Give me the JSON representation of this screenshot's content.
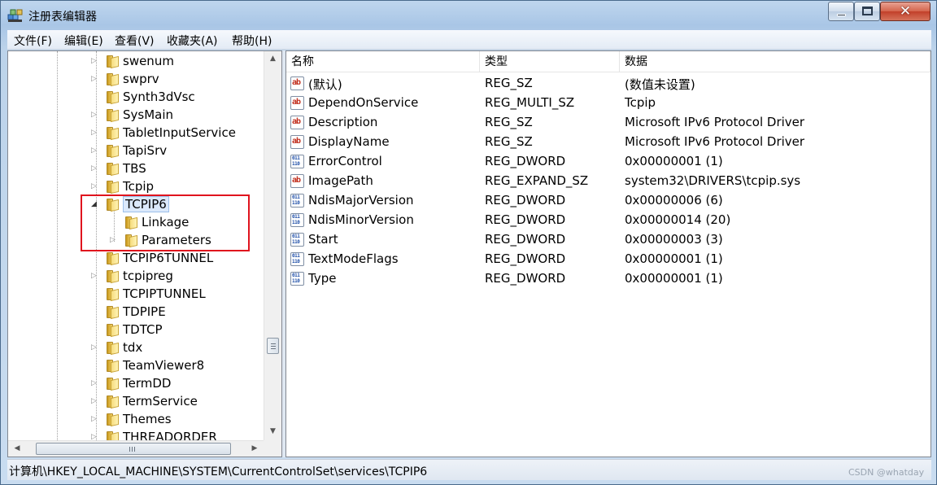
{
  "window": {
    "title": "注册表编辑器",
    "close_glyph": "✕"
  },
  "menu": [
    {
      "label": "文件(F)"
    },
    {
      "label": "编辑(E)"
    },
    {
      "label": "查看(V)"
    },
    {
      "label": "收藏夹(A)"
    },
    {
      "label": "帮助(H)"
    }
  ],
  "tree": {
    "items": [
      {
        "label": "swenum",
        "expander": "▷",
        "level": 1
      },
      {
        "label": "swprv",
        "expander": "▷",
        "level": 1
      },
      {
        "label": "Synth3dVsc",
        "expander": "",
        "level": 1
      },
      {
        "label": "SysMain",
        "expander": "▷",
        "level": 1
      },
      {
        "label": "TabletInputService",
        "expander": "▷",
        "level": 1
      },
      {
        "label": "TapiSrv",
        "expander": "▷",
        "level": 1
      },
      {
        "label": "TBS",
        "expander": "▷",
        "level": 1
      },
      {
        "label": "Tcpip",
        "expander": "▷",
        "level": 1
      },
      {
        "label": "TCPIP6",
        "expander": "◢",
        "level": 1,
        "selected": true
      },
      {
        "label": "Linkage",
        "expander": "",
        "level": 2
      },
      {
        "label": "Parameters",
        "expander": "▷",
        "level": 2
      },
      {
        "label": "TCPIP6TUNNEL",
        "expander": "",
        "level": 1
      },
      {
        "label": "tcpipreg",
        "expander": "▷",
        "level": 1
      },
      {
        "label": "TCPIPTUNNEL",
        "expander": "",
        "level": 1
      },
      {
        "label": "TDPIPE",
        "expander": "",
        "level": 1
      },
      {
        "label": "TDTCP",
        "expander": "",
        "level": 1
      },
      {
        "label": "tdx",
        "expander": "▷",
        "level": 1
      },
      {
        "label": "TeamViewer8",
        "expander": "",
        "level": 1
      },
      {
        "label": "TermDD",
        "expander": "▷",
        "level": 1
      },
      {
        "label": "TermService",
        "expander": "▷",
        "level": 1
      },
      {
        "label": "Themes",
        "expander": "▷",
        "level": 1
      },
      {
        "label": "THREADORDER",
        "expander": "▷",
        "level": 1
      }
    ],
    "scroll_up": "▲",
    "scroll_down": "▼",
    "scroll_left": "◀",
    "scroll_right": "▶"
  },
  "list": {
    "columns": [
      "名称",
      "类型",
      "数据"
    ],
    "rows": [
      {
        "icon": "string-value-icon",
        "name": "(默认)",
        "type": "REG_SZ",
        "data": "(数值未设置)"
      },
      {
        "icon": "string-value-icon",
        "name": "DependOnService",
        "type": "REG_MULTI_SZ",
        "data": "Tcpip"
      },
      {
        "icon": "string-value-icon",
        "name": "Description",
        "type": "REG_SZ",
        "data": "Microsoft IPv6 Protocol Driver"
      },
      {
        "icon": "string-value-icon",
        "name": "DisplayName",
        "type": "REG_SZ",
        "data": "Microsoft IPv6 Protocol Driver"
      },
      {
        "icon": "binary-value-icon",
        "name": "ErrorControl",
        "type": "REG_DWORD",
        "data": "0x00000001 (1)"
      },
      {
        "icon": "string-value-icon",
        "name": "ImagePath",
        "type": "REG_EXPAND_SZ",
        "data": "system32\\DRIVERS\\tcpip.sys"
      },
      {
        "icon": "binary-value-icon",
        "name": "NdisMajorVersion",
        "type": "REG_DWORD",
        "data": "0x00000006 (6)"
      },
      {
        "icon": "binary-value-icon",
        "name": "NdisMinorVersion",
        "type": "REG_DWORD",
        "data": "0x00000014 (20)"
      },
      {
        "icon": "binary-value-icon",
        "name": "Start",
        "type": "REG_DWORD",
        "data": "0x00000003 (3)"
      },
      {
        "icon": "binary-value-icon",
        "name": "TextModeFlags",
        "type": "REG_DWORD",
        "data": "0x00000001 (1)"
      },
      {
        "icon": "binary-value-icon",
        "name": "Type",
        "type": "REG_DWORD",
        "data": "0x00000001 (1)"
      }
    ],
    "icon_text": {
      "string": "ab",
      "binary": "011\n110"
    }
  },
  "status": {
    "path": "计算机\\HKEY_LOCAL_MACHINE\\SYSTEM\\CurrentControlSet\\services\\TCPIP6"
  },
  "watermark": "CSDN @whatday"
}
